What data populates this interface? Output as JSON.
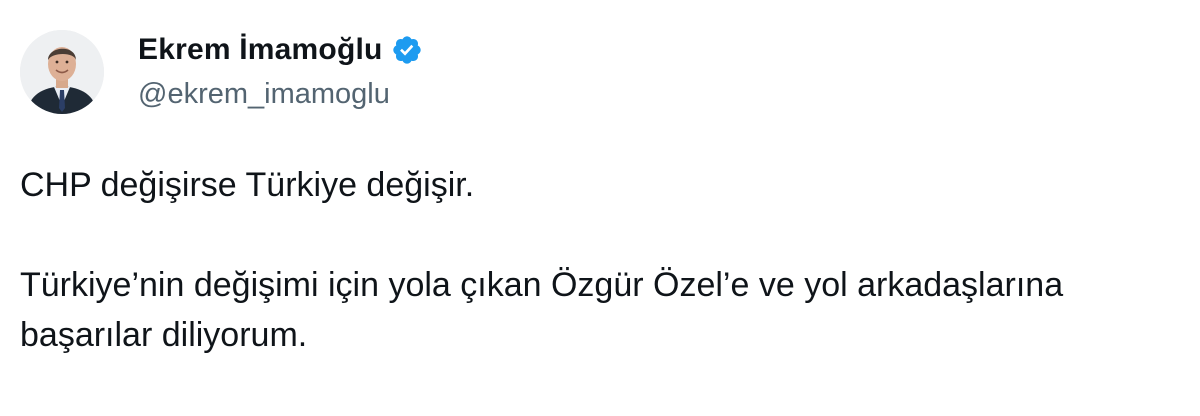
{
  "author": {
    "display_name": "Ekrem İmamoğlu",
    "handle": "@ekrem_imamoglu",
    "verified": true,
    "verified_icon": "verified-badge-icon",
    "avatar_icon": "profile-photo"
  },
  "tweet": {
    "paragraphs": [
      "CHP değişirse Türkiye değişir.",
      "Türkiye’nin değişimi için yola çıkan Özgür Özel’e ve yol arkadaşlarına başarılar diliyorum."
    ]
  },
  "colors": {
    "verified_blue": "#1d9bf0",
    "text": "#0f1419",
    "secondary_text": "#536471"
  }
}
